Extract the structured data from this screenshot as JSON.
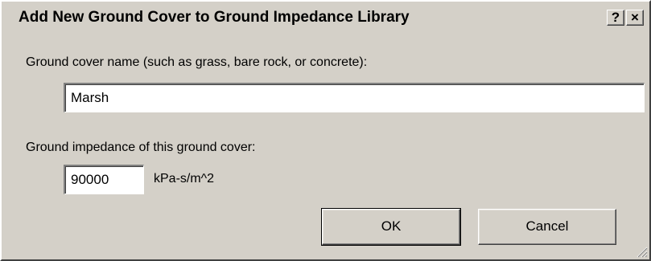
{
  "window": {
    "title": "Add New Ground Cover to Ground Impedance Library",
    "help_label": "?",
    "close_label": "×"
  },
  "form": {
    "name_label": "Ground cover name (such as grass, bare rock, or concrete):",
    "name_value": "Marsh",
    "impedance_label": "Ground impedance of this ground cover:",
    "impedance_value": "90000",
    "impedance_units": "kPa-s/m^2"
  },
  "buttons": {
    "ok_label": "OK",
    "cancel_label": "Cancel"
  },
  "colors": {
    "face": "#d4d0c8",
    "highlight": "#ffffff",
    "shadow": "#808080",
    "dark_shadow": "#404040"
  }
}
